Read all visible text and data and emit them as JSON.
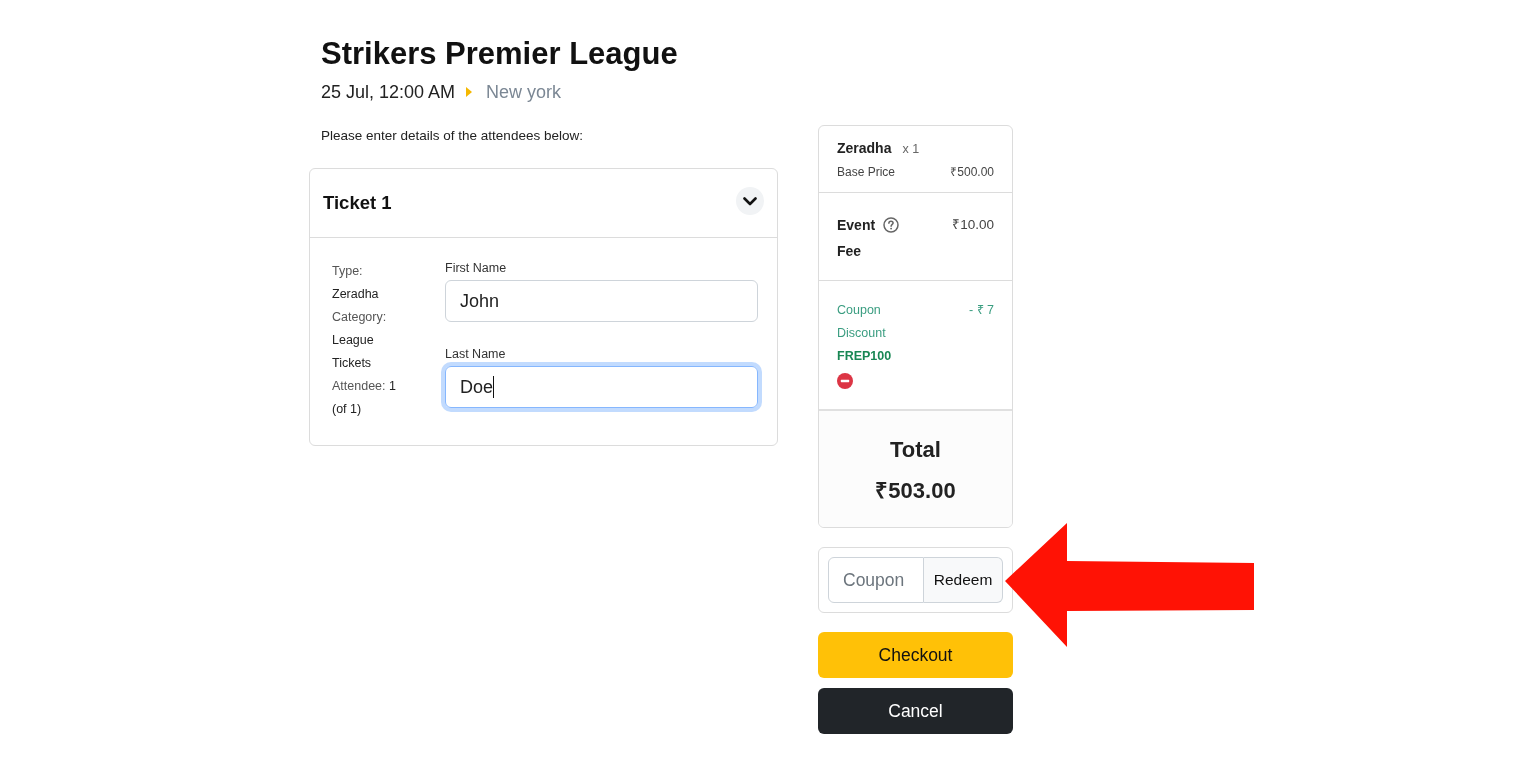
{
  "event": {
    "title": "Strikers Premier League",
    "datetime": "25 Jul, 12:00 AM",
    "location": "New york"
  },
  "instructions": "Please enter details of the attendees below:",
  "tickets": [
    {
      "title": "Ticket 1",
      "expanded": true,
      "details": [
        {
          "label": "Type:",
          "value": "Zeradha"
        },
        {
          "label": "Category:",
          "value": "League Tickets"
        },
        {
          "label": "Attendee:",
          "value": "1 (of 1)"
        }
      ],
      "fields": [
        {
          "label": "First Name",
          "value": "John",
          "focused": false
        },
        {
          "label": "Last Name",
          "value": "Doe",
          "focused": true
        }
      ]
    }
  ],
  "summary": {
    "items": [
      {
        "name": "Zeradha",
        "quantity": "x 1",
        "price_label": "Base Price",
        "price": "₹500.00"
      }
    ],
    "fee": {
      "label": "Event Fee",
      "amount": "₹10.00"
    },
    "discount": {
      "label": "Coupon Discount",
      "amount": "- ₹ 7",
      "code": "FREP100"
    },
    "total": {
      "label": "Total",
      "amount": "₹503.00"
    }
  },
  "coupon": {
    "placeholder": "Coupon",
    "button": "Redeem"
  },
  "buttons": [
    {
      "label": "Checkout",
      "kind": "primary"
    },
    {
      "label": "Cancel",
      "kind": "dark"
    }
  ],
  "annotation": {
    "kind": "arrow"
  }
}
